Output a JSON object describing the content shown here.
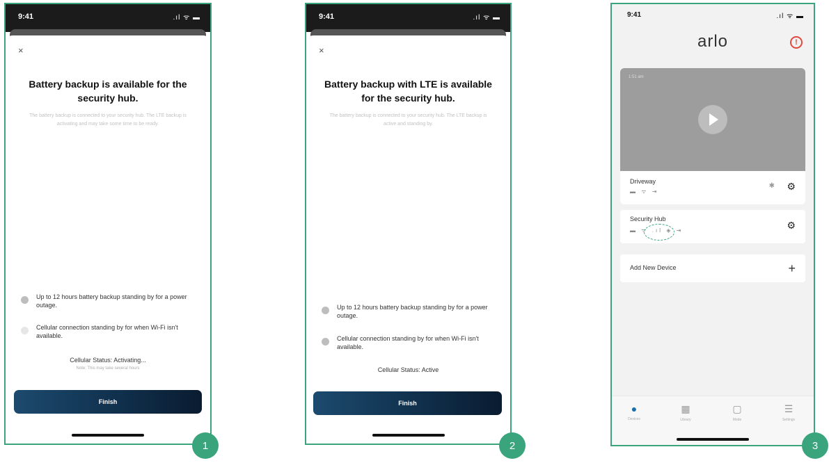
{
  "accent_color": "#3aa57d",
  "screens": [
    {
      "status_time": "9:41",
      "title": "Battery backup is available for the security hub.",
      "description": "The battery backup is connected to your security hub. The LTE backup is activating and may take some time to be ready.",
      "features": [
        "Up to 12 hours battery backup standing by for a power outage.",
        "Cellular connection standing by for when Wi-Fi isn't available."
      ],
      "cellular_status": "Cellular Status: Activating...",
      "cellular_note": "Note: This may take several hours",
      "finish_label": "Finish",
      "step": "1"
    },
    {
      "status_time": "9:41",
      "title": "Battery backup with LTE is available for the security hub.",
      "description": "The battery backup is connected to your security hub. The LTE backup is active and standing by.",
      "features": [
        "Up to 12 hours battery backup standing by for a power outage.",
        "Cellular connection standing by for when Wi-Fi isn't available."
      ],
      "cellular_status": "Cellular Status: Active",
      "finish_label": "Finish",
      "step": "2"
    },
    {
      "status_time": "9:41",
      "logo": "arlo",
      "thumbnail_time": "1:51 am",
      "devices": [
        {
          "name": "Driveway",
          "status_icons": "▬ ᯤ ⇥"
        },
        {
          "name": "Security Hub",
          "status_icons": "▬ ᯤ .ıl ◈ ⇥"
        }
      ],
      "add_device_label": "Add New Device",
      "tabs": [
        "Devices",
        "Library",
        "Mode",
        "Settings"
      ],
      "step": "3"
    }
  ]
}
